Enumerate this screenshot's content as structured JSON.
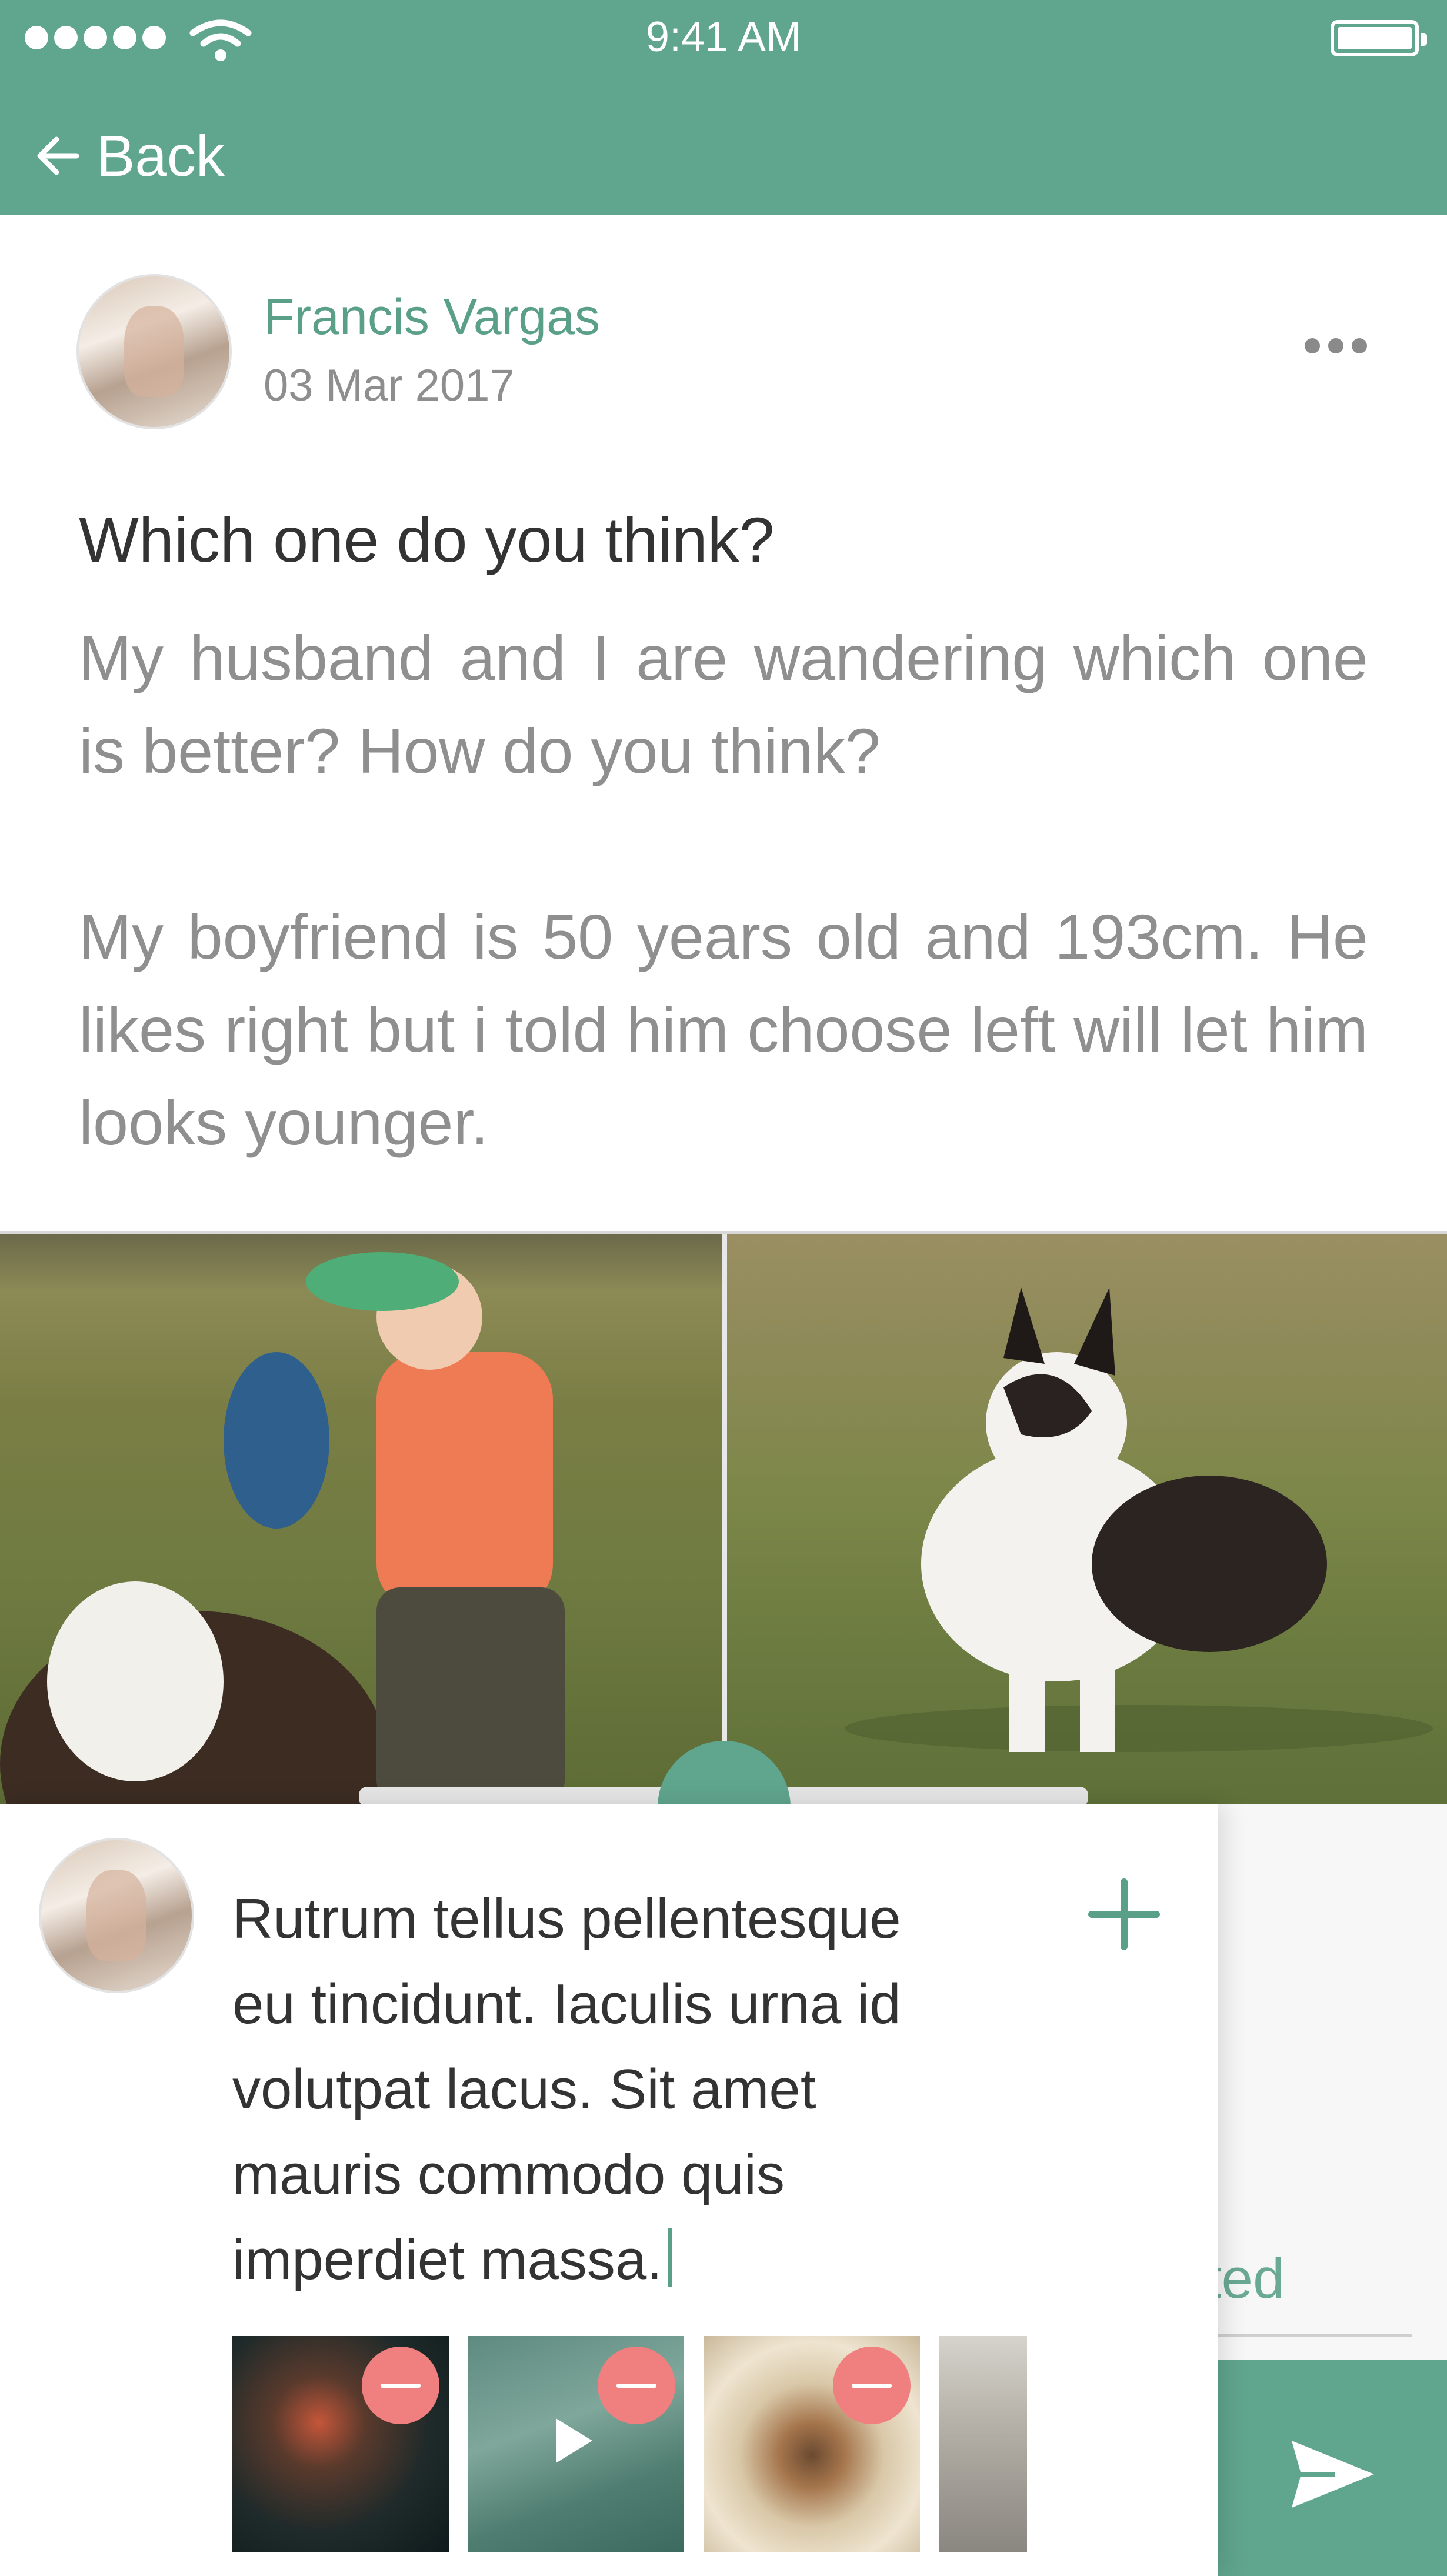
{
  "status_bar": {
    "time": "9:41 AM",
    "signal_icon": "signal-dots-icon",
    "wifi_icon": "wifi-icon",
    "battery_icon": "battery-icon"
  },
  "nav": {
    "back_label": "Back",
    "back_icon": "arrow-left-icon"
  },
  "post": {
    "author": "Francis Vargas",
    "date": "03 Mar 2017",
    "more_icon": "more-dots-icon",
    "title": "Which one do you think?",
    "paragraph_1": "My husband and I are wandering which one is better? How do you think?",
    "paragraph_2": "My boyfriend is 50 years old and 193cm. He likes right but i told him choose left will let him looks younger.",
    "image_left": "photo-child-with-dog",
    "image_right": "photo-corgi-on-grass",
    "compare_icon": "compare-arrows-icon"
  },
  "composer": {
    "text": "Rutrum tellus pellentesque\neu tincidunt. Iaculis urna id\nvolutpat lacus. Sit amet\nmauris commodo quis\nimperdiet massa.",
    "add_icon": "plus-icon",
    "placeholder_fragment": "ted",
    "send_icon": "send-icon",
    "attachments": [
      {
        "kind": "image",
        "remove_icon": "remove-icon"
      },
      {
        "kind": "video",
        "remove_icon": "remove-icon"
      },
      {
        "kind": "image",
        "remove_icon": "remove-icon"
      },
      {
        "kind": "image"
      }
    ]
  },
  "colors": {
    "brand": "#60a58e",
    "remove": "#f07f7f",
    "text_dark": "#333333",
    "text_muted": "#8f8f8f"
  }
}
